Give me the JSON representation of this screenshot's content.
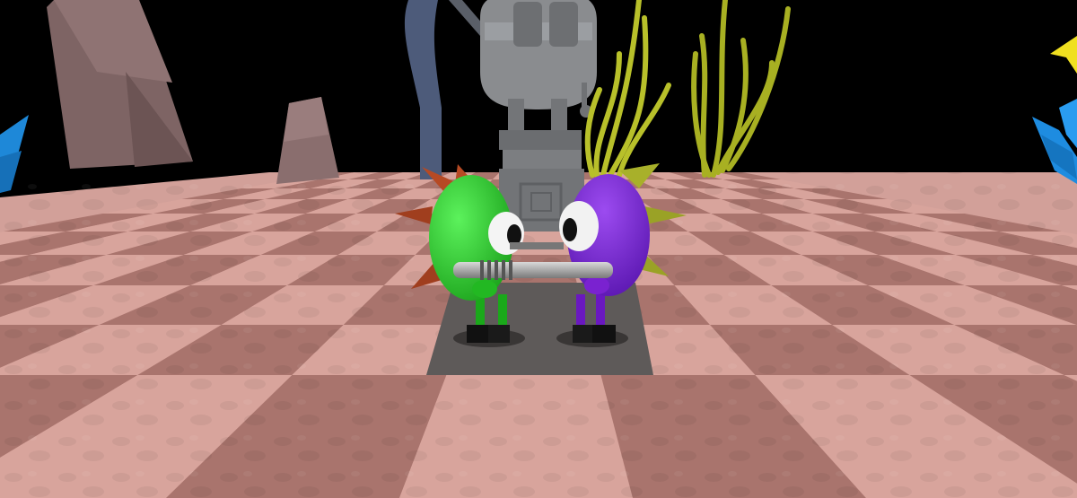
{
  "scene": {
    "sky_color": "#000000",
    "floor_light": "#d8a49c",
    "floor_dark": "#a9746d",
    "stage_color": "#5e5a59",
    "characters": [
      {
        "name": "green-creature",
        "body_color": "#2ad22a",
        "spike_color": "#b64a24"
      },
      {
        "name": "purple-creature",
        "body_color": "#7a1fd6",
        "spike_color": "#a8b02a"
      }
    ],
    "props": [
      "rock-pillar",
      "stone-statue",
      "yellow-seaweed",
      "blue-crystal",
      "yellow-star",
      "metal-rod"
    ]
  }
}
